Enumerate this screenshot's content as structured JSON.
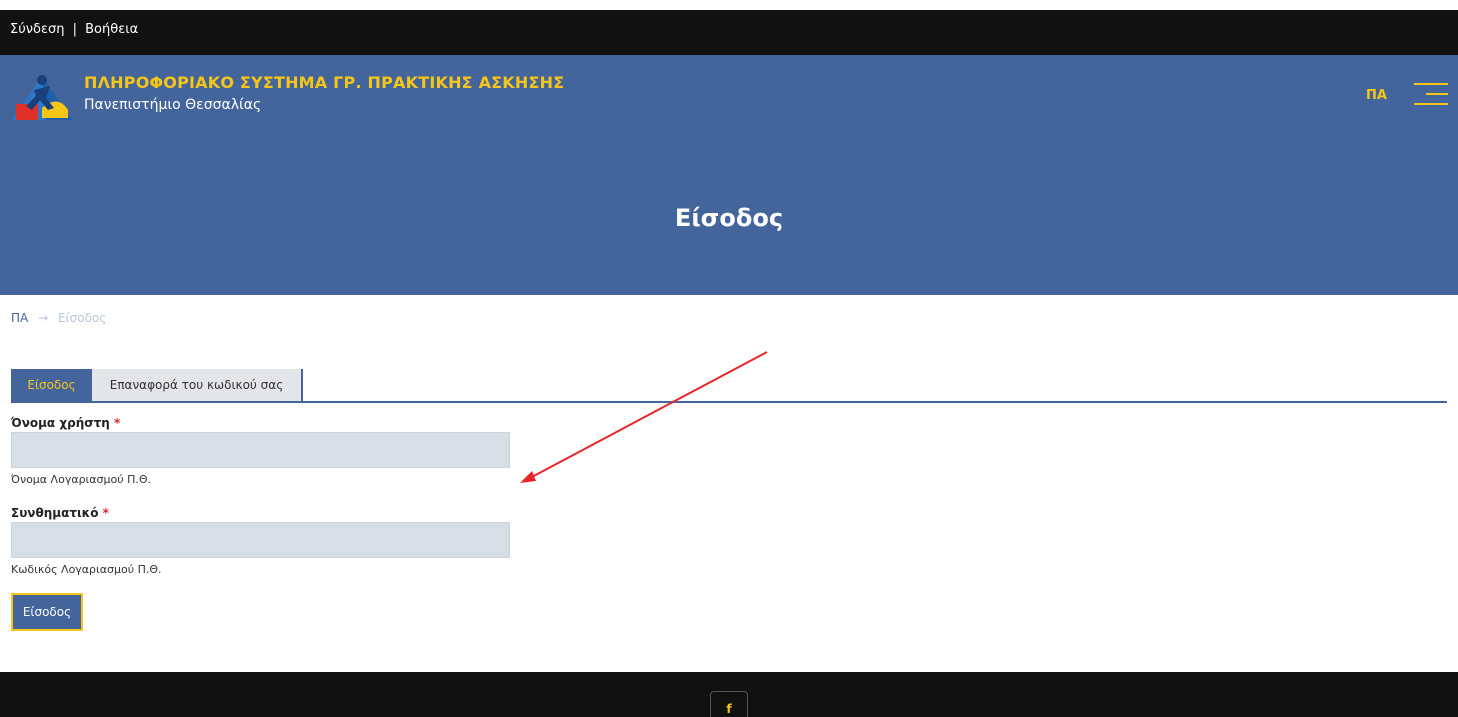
{
  "top_bar": {
    "login_link": "Σύνδεση",
    "separator": "|",
    "help_link": "Βοήθεια"
  },
  "header": {
    "site_title": "ΠΛΗΡΟΦΟΡΙΑΚΟ ΣΥΣΤΗΜΑ ΓΡ. ΠΡΑΚΤΙΚΗΣ ΑΣΚΗΣΗΣ",
    "site_subtitle": "Πανεπιστήμιο Θεσσαλίας",
    "lang_label": "ΠΑ",
    "menu_icon": "hamburger-icon",
    "page_heading": "Είσοδος"
  },
  "breadcrumb": {
    "home": "ΠΑ",
    "arrow": "→",
    "current": "Είσοδος"
  },
  "tabs": [
    {
      "label": "Είσοδος",
      "active": true
    },
    {
      "label": "Επαναφορά του κωδικού σας",
      "active": false
    }
  ],
  "form": {
    "username_label": "Όνομα χρήστη",
    "username_value": "",
    "username_help": "Όνομα Λογαριασμού Π.Θ.",
    "password_label": "Συνθηματικό",
    "password_value": "",
    "password_help": "Κωδικός Λογαριασμού Π.Θ.",
    "required_mark": "*",
    "submit_label": "Είσοδος"
  },
  "footer": {
    "facebook_label": "f",
    "facebook_icon": "facebook-icon"
  },
  "colors": {
    "brand_blue": "#44659b",
    "accent_yellow": "#f5c518",
    "dark_bar": "#111111",
    "annotation_red": "#e8262a"
  }
}
